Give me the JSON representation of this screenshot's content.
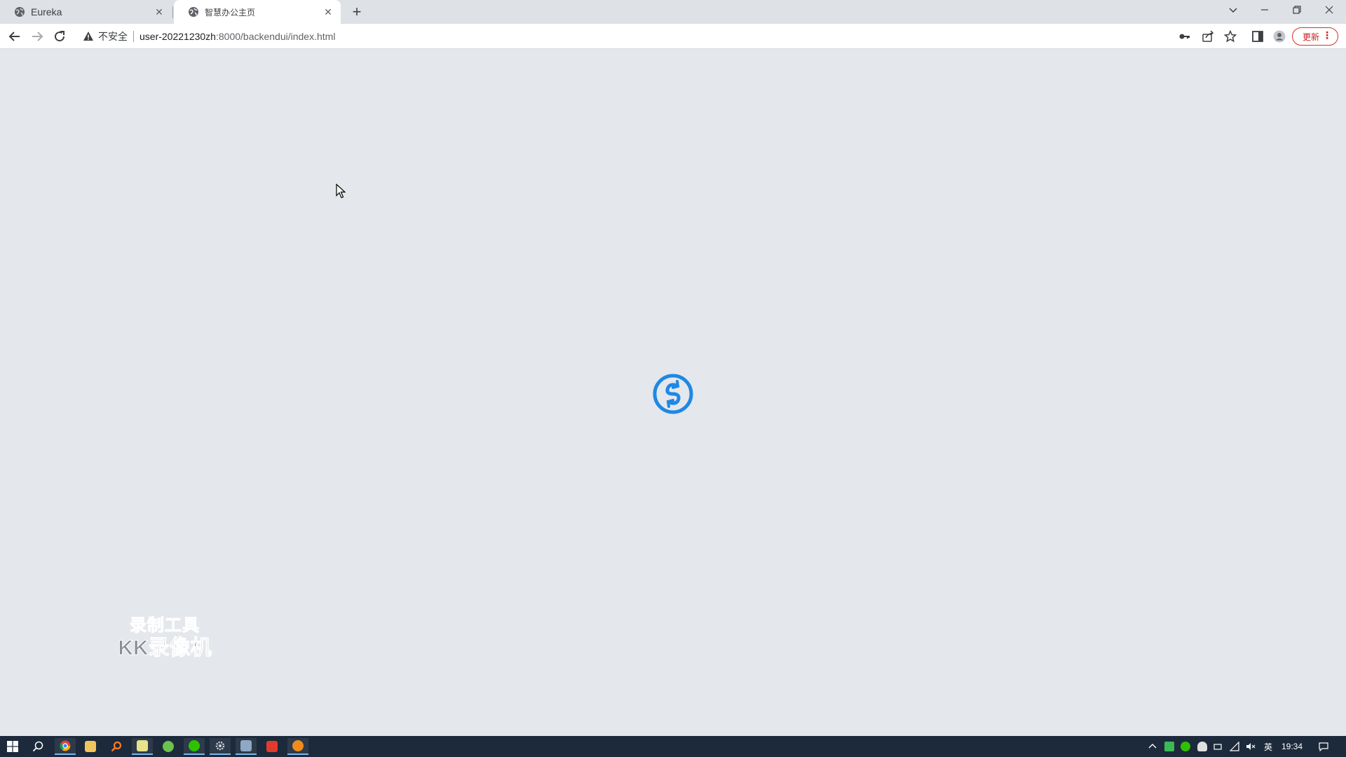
{
  "browser": {
    "tabs": [
      {
        "title": "Eureka",
        "active": false
      },
      {
        "title": "智慧办公主页",
        "active": true
      }
    ],
    "address": {
      "security_label": "不安全",
      "host": "user-20221230zh",
      "path": ":8000/backendui/index.html"
    },
    "update_label": "更新"
  },
  "watermark": {
    "line1": "录制工具",
    "line2": "KK录像机"
  },
  "taskbar": {
    "clock": "19:34",
    "ime": "英"
  },
  "colors": {
    "spinner": "#1e88e5",
    "page_background": "#e4e7ec",
    "taskbar": "#1c2a3b",
    "update_accent": "#d93025"
  }
}
